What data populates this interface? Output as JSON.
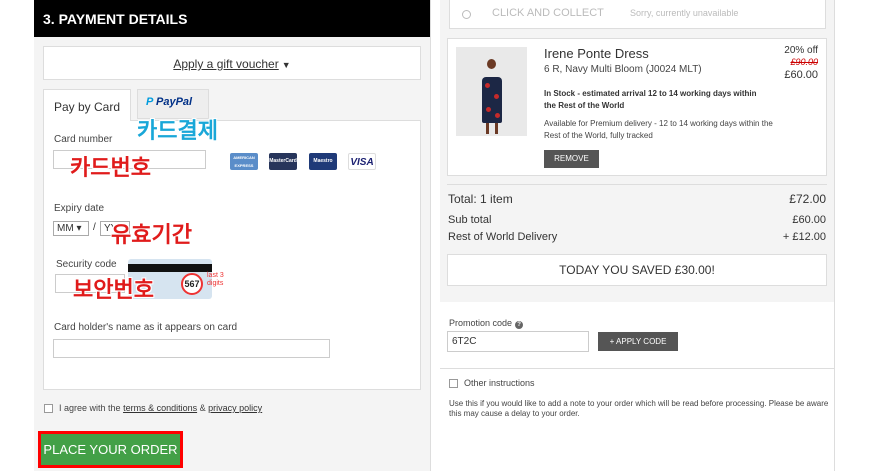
{
  "left": {
    "section_title": "3. PAYMENT DETAILS",
    "gift_voucher": "Apply a gift voucher",
    "tabs": [
      {
        "label": "Pay by Card"
      },
      {
        "label_p": "P",
        "label_rest": "PayPal"
      }
    ],
    "card_number_label": "Card number",
    "card_number_value": "",
    "card_brands": [
      "AMERICAN EXPRESS",
      "MasterCard",
      "Maestro",
      "VISA"
    ],
    "expiry_label": "Expiry date",
    "expiry_month": "MM ▾",
    "expiry_slash": "/",
    "expiry_year": "YY",
    "security_label": "Security code",
    "security_value": "",
    "cvv_example": "567",
    "cvv_hint": "last 3 digits",
    "holder_label": "Card holder's name as it appears on card",
    "holder_value": "",
    "annotations": {
      "card_payment": "카드결제",
      "card_number": "카드번호",
      "expiry": "유효기간",
      "security": "보안번호"
    },
    "agree_prefix": "I agree with the",
    "terms_link": "terms & conditions",
    "agree_amp": "&",
    "privacy_link": "privacy policy",
    "place_order": "PLACE YOUR ORDER"
  },
  "right": {
    "collect_label": "CLICK AND COLLECT",
    "collect_note": "Sorry, currently unavailable",
    "product": {
      "name": "Irene Ponte Dress",
      "sku": "6 R, Navy Multi Bloom (J0024 MLT)",
      "stock": "In Stock - estimated arrival 12 to 14 working days within the Rest of the World",
      "premium": "Available for Premium delivery - 12 to 14 working days within the Rest of the World, fully tracked",
      "remove": "REMOVE",
      "discount": "20% off",
      "was": "£90.00",
      "now": "£60.00"
    },
    "total_label": "Total: 1 item",
    "total_value": "£72.00",
    "subtotal_label": "Sub total",
    "subtotal_value": "£60.00",
    "delivery_label": "Rest of World Delivery",
    "delivery_value": "+ £12.00",
    "saved": "TODAY YOU SAVED £30.00!",
    "promo_label": "Promotion code",
    "promo_help": "?",
    "promo_value": "6T2C",
    "apply_code": "+ APPLY CODE",
    "other_label": "Other instructions",
    "other_note": "Use this if you would like to add a note to your order which will be read before processing. Please be aware this may cause a delay to your order."
  }
}
